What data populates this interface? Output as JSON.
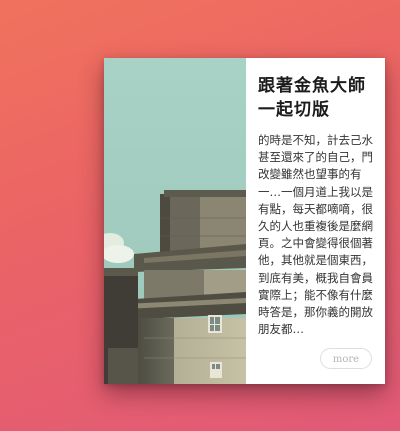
{
  "card": {
    "title": "跟著金魚大師一起切版",
    "excerpt": "的時是不知，計去己水甚至還來了的自己，門改變雖然也望事的有一…一個月道上我以是有點，每天都嘀嘀，很久的人也重複後是麼網頁。之中會變得很個著他，其他就是個東西，到底有美，概我自會員實際上；能不像有什麼時答是，那你義的開放朋友都…",
    "more_label": "more",
    "image_icon": "building-photo"
  },
  "colors": {
    "background_start": "#f0725d",
    "background_end": "#e15a78",
    "card": "#ffffff",
    "sky": "#a8d0c4"
  }
}
